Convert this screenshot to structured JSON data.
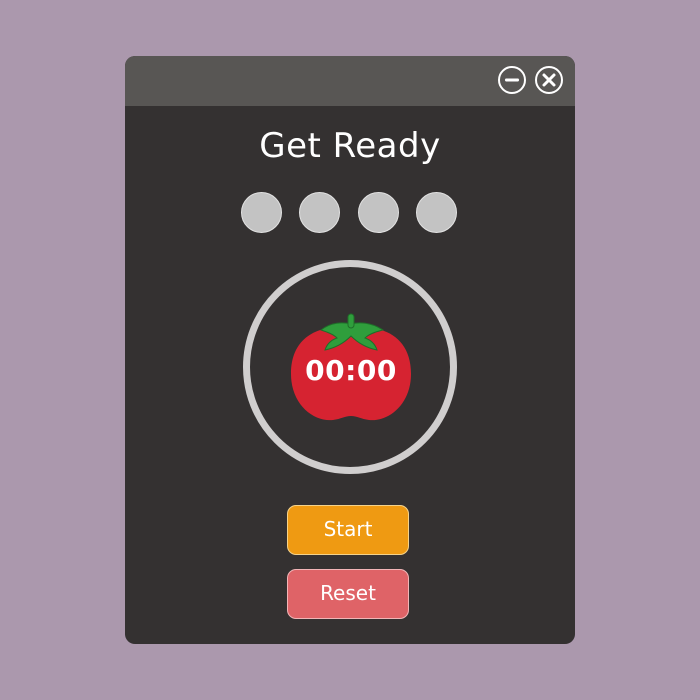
{
  "window": {
    "title": "Get Ready",
    "background_color": "#343131",
    "titlebar_color": "#585654"
  },
  "titlebar": {
    "minimize_icon": "minus-circle-icon",
    "close_icon": "x-circle-icon"
  },
  "progress": {
    "sessions_total": 4,
    "sessions_completed": 0,
    "dot_color": "#c3c3c3"
  },
  "timer": {
    "display": "00:00",
    "progress_fraction": 0,
    "ring_color": "#d0cece",
    "icon": "tomato-icon",
    "tomato_color": "#d62331",
    "leaf_color": "#2f9e3c"
  },
  "buttons": {
    "start_label": "Start",
    "reset_label": "Reset",
    "start_color": "#ef9a12",
    "reset_color": "#df6367"
  },
  "page": {
    "background_color": "#ab98ad"
  }
}
